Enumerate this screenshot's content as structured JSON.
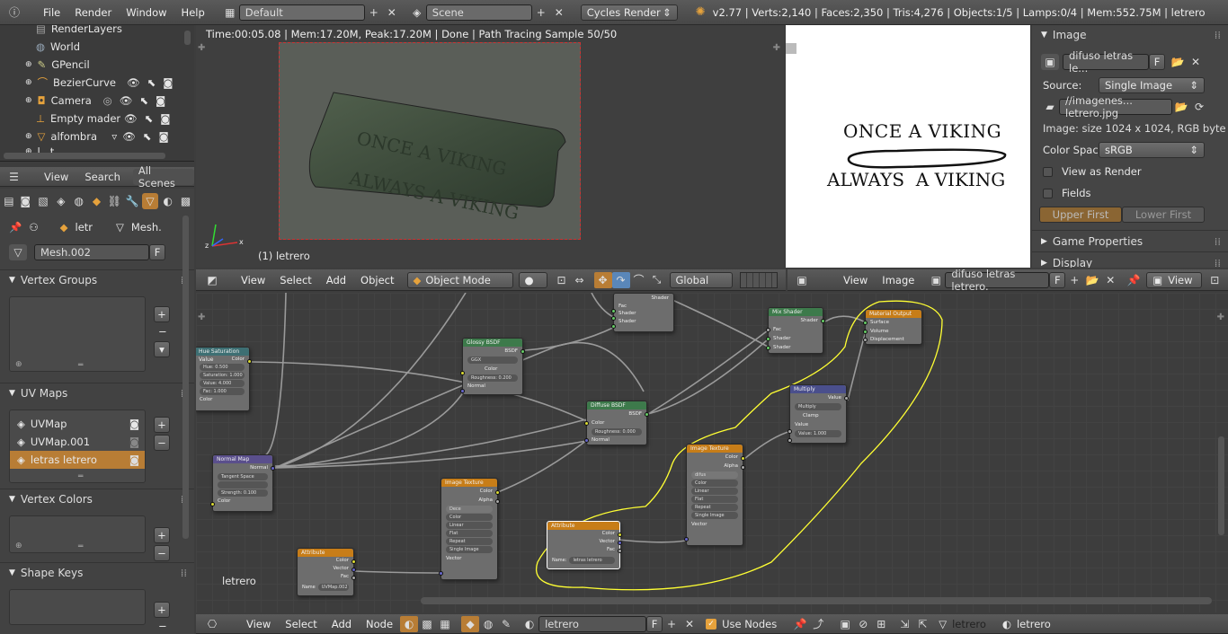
{
  "topbar": {
    "menus": [
      "File",
      "Render",
      "Window",
      "Help"
    ],
    "layout": "Default",
    "scene": "Scene",
    "engine": "Cycles Render",
    "stats": "v2.77 | Verts:2,140 | Faces:2,350 | Tris:4,276 | Objects:1/5 | Lamps:0/4 | Mem:552.75M | letrero"
  },
  "outliner": {
    "items": [
      {
        "label": "RenderLayers"
      },
      {
        "label": "World"
      },
      {
        "label": "GPencil"
      },
      {
        "label": "BezierCurve"
      },
      {
        "label": "Camera"
      },
      {
        "label": "Empty madera s"
      },
      {
        "label": "alfombra"
      },
      {
        "label": "l...t"
      }
    ],
    "tabs": [
      "View",
      "Search",
      "All Scenes"
    ]
  },
  "properties": {
    "breadcrumb_obj": "letr",
    "breadcrumb_mesh": "Mesh.",
    "mesh_name": "Mesh.002",
    "fake_user": "F",
    "sections": {
      "vertex_groups": "Vertex Groups",
      "uv_maps": "UV Maps",
      "vertex_colors": "Vertex Colors",
      "shape_keys": "Shape Keys"
    },
    "uv_maps": [
      "UVMap",
      "UVMap.001",
      "letras letrero"
    ]
  },
  "viewport": {
    "status": "Time:00:05.08 | Mem:17.20M, Peak:17.20M | Done | Path Tracing Sample 50/50",
    "object_label": "(1) letrero",
    "sign_line1": "ONCE A VIKING",
    "sign_line2": "ALWAYS A VIKING",
    "header": {
      "menus": [
        "View",
        "Select",
        "Add",
        "Object"
      ],
      "mode": "Object Mode",
      "orientation": "Global"
    }
  },
  "image_editor": {
    "line1": "ONCE A VIKING",
    "line2": "ALWAYS  A VIKING",
    "header": {
      "menus": [
        "View",
        "Image"
      ],
      "image": "difuso letras letrero.",
      "view": "View"
    }
  },
  "image_panel": {
    "title": "Image",
    "image_name": "difuso letras le...",
    "source_label": "Source:",
    "source_value": "Single Image",
    "filepath": "//imagenes... letrero.jpg",
    "info": "Image: size 1024 x 1024, RGB byte",
    "colorspace_label": "Color Spac",
    "colorspace_value": "sRGB",
    "view_as_render": "View as Render",
    "fields": "Fields",
    "upper_first": "Upper First",
    "lower_first": "Lower First",
    "game_properties": "Game Properties",
    "display": "Display"
  },
  "node_editor": {
    "header": {
      "menus": [
        "View",
        "Select",
        "Add",
        "Node"
      ],
      "material": "letrero",
      "use_nodes": "Use Nodes",
      "object": "letrero",
      "mat_slot": "letrero"
    },
    "material_label": "letrero",
    "nodes": {
      "hsv": {
        "title": "Hue Saturation Value",
        "out": "Color",
        "f1": "Hue: 0.500",
        "f2": "Saturation: 1.000",
        "f3": "Value: 4.000",
        "f4": "Fac: 1.000",
        "in": "Color"
      },
      "normalmap": {
        "title": "Normal Map",
        "out": "Normal",
        "f1": "Tangent Space",
        "f2": "",
        "f3": "Strength: 0.100",
        "in": "Color"
      },
      "glossy": {
        "title": "Glossy BSDF",
        "out": "BSDF",
        "f1": "GGX",
        "in1": "Color",
        "f2": "Roughness: 0.200",
        "in2": "Normal"
      },
      "diffuse": {
        "title": "Diffuse BSDF",
        "out": "BSDF",
        "in1": "Color",
        "f1": "Roughness: 0.000",
        "in2": "Normal"
      },
      "mix_top": {
        "out": "Shader",
        "in1": "Fac",
        "in2": "Shader",
        "in3": "Shader"
      },
      "mixshader": {
        "title": "Mix Shader",
        "out": "Shader",
        "in1": "Fac",
        "in2": "Shader",
        "in3": "Shader"
      },
      "output": {
        "title": "Material Output",
        "in1": "Surface",
        "in2": "Volume",
        "in3": "Displacement"
      },
      "multiply": {
        "title": "Multiply",
        "out": "Value",
        "f1": "Multiply",
        "f2": "Clamp",
        "in1": "Value",
        "f3": "Value: 1.000"
      },
      "imgtex1": {
        "title": "Image Texture",
        "out1": "Color",
        "out2": "Alpha",
        "f0": "difus",
        "f1": "Color",
        "f2": "Linear",
        "f3": "Flat",
        "f4": "Repeat",
        "f5": "Single Image",
        "in": "Vector"
      },
      "imgtex2": {
        "title": "Image Texture",
        "out1": "Color",
        "out2": "Alpha",
        "f0": "Dece",
        "f1": "Color",
        "f2": "Linear",
        "f3": "Flat",
        "f4": "Repeat",
        "f5": "Single Image",
        "in": "Vector"
      },
      "attr1": {
        "title": "Attribute",
        "out1": "Color",
        "out2": "Vector",
        "out3": "Fac",
        "name": "Name:",
        "value": "letras letrero"
      },
      "attr2": {
        "title": "Attribute",
        "out1": "Color",
        "out2": "Vector",
        "out3": "Fac",
        "name": "Name",
        "value": "UVMap.002"
      }
    }
  },
  "colors": {
    "accent": "#e6a23c",
    "selection": "#b87d35",
    "highlight_line": "#ffff33"
  }
}
